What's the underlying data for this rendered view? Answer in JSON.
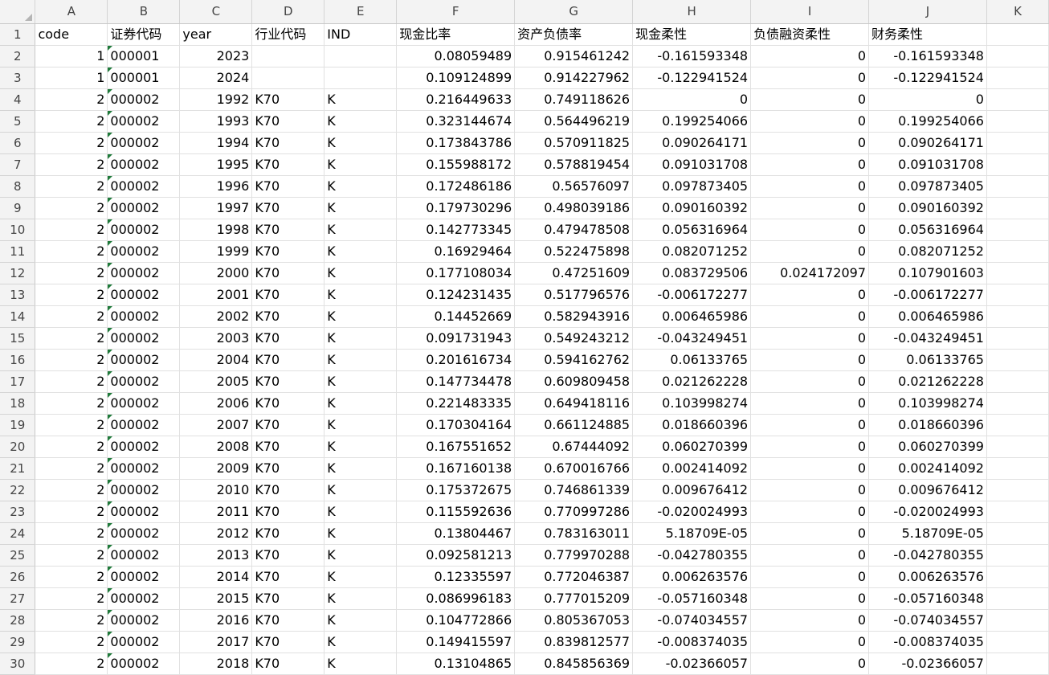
{
  "column_headers": [
    "A",
    "B",
    "C",
    "D",
    "E",
    "F",
    "G",
    "H",
    "I",
    "J",
    "K"
  ],
  "header_row": {
    "row_number": "1",
    "cells": [
      "code",
      "证券代码",
      "year",
      "行业代码",
      "IND",
      "现金比率",
      "资产负债率",
      "现金柔性",
      "负债融资柔性",
      "财务柔性",
      ""
    ]
  },
  "rows": [
    {
      "n": "2",
      "cells": [
        "1",
        "000001",
        "2023",
        "",
        "",
        "0.08059489",
        "0.915461242",
        "-0.161593348",
        "0",
        "-0.161593348",
        ""
      ]
    },
    {
      "n": "3",
      "cells": [
        "1",
        "000001",
        "2024",
        "",
        "",
        "0.109124899",
        "0.914227962",
        "-0.122941524",
        "0",
        "-0.122941524",
        ""
      ]
    },
    {
      "n": "4",
      "cells": [
        "2",
        "000002",
        "1992",
        "K70",
        "K",
        "0.216449633",
        "0.749118626",
        "0",
        "0",
        "0",
        ""
      ]
    },
    {
      "n": "5",
      "cells": [
        "2",
        "000002",
        "1993",
        "K70",
        "K",
        "0.323144674",
        "0.564496219",
        "0.199254066",
        "0",
        "0.199254066",
        ""
      ]
    },
    {
      "n": "6",
      "cells": [
        "2",
        "000002",
        "1994",
        "K70",
        "K",
        "0.173843786",
        "0.570911825",
        "0.090264171",
        "0",
        "0.090264171",
        ""
      ]
    },
    {
      "n": "7",
      "cells": [
        "2",
        "000002",
        "1995",
        "K70",
        "K",
        "0.155988172",
        "0.578819454",
        "0.091031708",
        "0",
        "0.091031708",
        ""
      ]
    },
    {
      "n": "8",
      "cells": [
        "2",
        "000002",
        "1996",
        "K70",
        "K",
        "0.172486186",
        "0.56576097",
        "0.097873405",
        "0",
        "0.097873405",
        ""
      ]
    },
    {
      "n": "9",
      "cells": [
        "2",
        "000002",
        "1997",
        "K70",
        "K",
        "0.179730296",
        "0.498039186",
        "0.090160392",
        "0",
        "0.090160392",
        ""
      ]
    },
    {
      "n": "10",
      "cells": [
        "2",
        "000002",
        "1998",
        "K70",
        "K",
        "0.142773345",
        "0.479478508",
        "0.056316964",
        "0",
        "0.056316964",
        ""
      ]
    },
    {
      "n": "11",
      "cells": [
        "2",
        "000002",
        "1999",
        "K70",
        "K",
        "0.16929464",
        "0.522475898",
        "0.082071252",
        "0",
        "0.082071252",
        ""
      ]
    },
    {
      "n": "12",
      "cells": [
        "2",
        "000002",
        "2000",
        "K70",
        "K",
        "0.177108034",
        "0.47251609",
        "0.083729506",
        "0.024172097",
        "0.107901603",
        ""
      ]
    },
    {
      "n": "13",
      "cells": [
        "2",
        "000002",
        "2001",
        "K70",
        "K",
        "0.124231435",
        "0.517796576",
        "-0.006172277",
        "0",
        "-0.006172277",
        ""
      ]
    },
    {
      "n": "14",
      "cells": [
        "2",
        "000002",
        "2002",
        "K70",
        "K",
        "0.14452669",
        "0.582943916",
        "0.006465986",
        "0",
        "0.006465986",
        ""
      ]
    },
    {
      "n": "15",
      "cells": [
        "2",
        "000002",
        "2003",
        "K70",
        "K",
        "0.091731943",
        "0.549243212",
        "-0.043249451",
        "0",
        "-0.043249451",
        ""
      ]
    },
    {
      "n": "16",
      "cells": [
        "2",
        "000002",
        "2004",
        "K70",
        "K",
        "0.201616734",
        "0.594162762",
        "0.06133765",
        "0",
        "0.06133765",
        ""
      ]
    },
    {
      "n": "17",
      "cells": [
        "2",
        "000002",
        "2005",
        "K70",
        "K",
        "0.147734478",
        "0.609809458",
        "0.021262228",
        "0",
        "0.021262228",
        ""
      ]
    },
    {
      "n": "18",
      "cells": [
        "2",
        "000002",
        "2006",
        "K70",
        "K",
        "0.221483335",
        "0.649418116",
        "0.103998274",
        "0",
        "0.103998274",
        ""
      ]
    },
    {
      "n": "19",
      "cells": [
        "2",
        "000002",
        "2007",
        "K70",
        "K",
        "0.170304164",
        "0.661124885",
        "0.018660396",
        "0",
        "0.018660396",
        ""
      ]
    },
    {
      "n": "20",
      "cells": [
        "2",
        "000002",
        "2008",
        "K70",
        "K",
        "0.167551652",
        "0.67444092",
        "0.060270399",
        "0",
        "0.060270399",
        ""
      ]
    },
    {
      "n": "21",
      "cells": [
        "2",
        "000002",
        "2009",
        "K70",
        "K",
        "0.167160138",
        "0.670016766",
        "0.002414092",
        "0",
        "0.002414092",
        ""
      ]
    },
    {
      "n": "22",
      "cells": [
        "2",
        "000002",
        "2010",
        "K70",
        "K",
        "0.175372675",
        "0.746861339",
        "0.009676412",
        "0",
        "0.009676412",
        ""
      ]
    },
    {
      "n": "23",
      "cells": [
        "2",
        "000002",
        "2011",
        "K70",
        "K",
        "0.115592636",
        "0.770997286",
        "-0.020024993",
        "0",
        "-0.020024993",
        ""
      ]
    },
    {
      "n": "24",
      "cells": [
        "2",
        "000002",
        "2012",
        "K70",
        "K",
        "0.13804467",
        "0.783163011",
        "5.18709E-05",
        "0",
        "5.18709E-05",
        ""
      ]
    },
    {
      "n": "25",
      "cells": [
        "2",
        "000002",
        "2013",
        "K70",
        "K",
        "0.092581213",
        "0.779970288",
        "-0.042780355",
        "0",
        "-0.042780355",
        ""
      ]
    },
    {
      "n": "26",
      "cells": [
        "2",
        "000002",
        "2014",
        "K70",
        "K",
        "0.12335597",
        "0.772046387",
        "0.006263576",
        "0",
        "0.006263576",
        ""
      ]
    },
    {
      "n": "27",
      "cells": [
        "2",
        "000002",
        "2015",
        "K70",
        "K",
        "0.086996183",
        "0.777015209",
        "-0.057160348",
        "0",
        "-0.057160348",
        ""
      ]
    },
    {
      "n": "28",
      "cells": [
        "2",
        "000002",
        "2016",
        "K70",
        "K",
        "0.104772866",
        "0.805367053",
        "-0.074034557",
        "0",
        "-0.074034557",
        ""
      ]
    },
    {
      "n": "29",
      "cells": [
        "2",
        "000002",
        "2017",
        "K70",
        "K",
        "0.149415597",
        "0.839812577",
        "-0.008374035",
        "0",
        "-0.008374035",
        ""
      ]
    },
    {
      "n": "30",
      "cells": [
        "2",
        "000002",
        "2018",
        "K70",
        "K",
        "0.13104865",
        "0.845856369",
        "-0.02366057",
        "0",
        "-0.02366057",
        ""
      ]
    }
  ]
}
